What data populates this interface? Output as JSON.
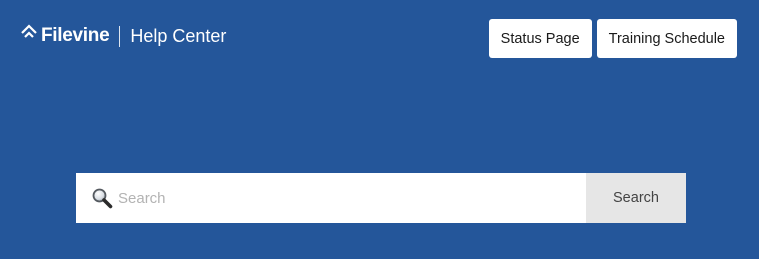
{
  "brand": {
    "logo_text": "Filevine",
    "subtitle": "Help Center"
  },
  "header": {
    "buttons": [
      {
        "label": "Status Page"
      },
      {
        "label": "Training Schedule"
      }
    ]
  },
  "search": {
    "placeholder": "Search",
    "value": "",
    "button_label": "Search",
    "icon": "magnifying-glass"
  },
  "colors": {
    "background": "#24569a",
    "header_button_bg": "#ffffff",
    "search_button_bg": "#e6e6e6"
  }
}
